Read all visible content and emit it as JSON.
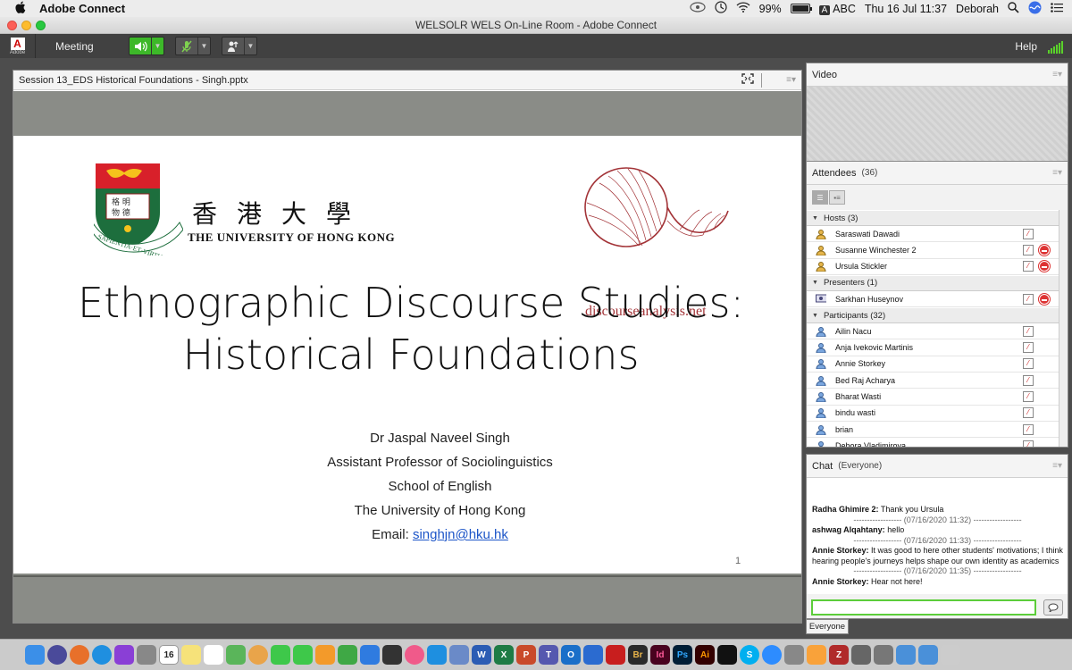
{
  "menubar": {
    "apple": "",
    "app_name": "Adobe Connect",
    "battery": "99%",
    "input_source": "ABC",
    "datetime": "Thu 16 Jul  11:37",
    "user": "Deborah"
  },
  "window": {
    "title": "WELSOLR WELS On-Line Room - Adobe Connect"
  },
  "toolbar": {
    "logo_sub": "Adobe",
    "meeting_label": "Meeting",
    "help_label": "Help"
  },
  "share_pod": {
    "title": "Session 13_EDS Historical Foundations - Singh.pptx",
    "slide": {
      "hku_chinese": "香港大學",
      "hku_name": "THE UNIVERSITY OF HONG KONG",
      "hku_motto": "SAPIENTIA·ET·VIRTUS",
      "da_name": "discourseanalysis.net",
      "title_line1": "Ethnographic Discourse Studies:",
      "title_line2": "Historical Foundations",
      "author": "Dr Jaspal Naveel Singh",
      "position": "Assistant Professor of Sociolinguistics",
      "school": "School of English",
      "university": "The University of Hong Kong",
      "email_label": "Email: ",
      "email": "singhjn@hku.hk",
      "page": "1"
    }
  },
  "video_pod": {
    "title": "Video"
  },
  "attendees_pod": {
    "title": "Attendees",
    "count": "(36)",
    "groups": {
      "hosts": "Hosts (3)",
      "presenters": "Presenters (1)",
      "participants": "Participants (32)"
    },
    "hosts": [
      "Saraswati Dawadi",
      "Susanne Winchester 2",
      "Ursula Stickler"
    ],
    "presenters": [
      "Sarkhan Huseynov"
    ],
    "participants": [
      "Ailin Nacu",
      "Anja Ivekovic Martinis",
      "Annie Storkey",
      "Bed Raj Acharya",
      "Bharat Wasti",
      "bindu wasti",
      "brian",
      "Debora Vladimirova"
    ]
  },
  "chat_pod": {
    "title": "Chat",
    "scope": "(Everyone)",
    "messages": [
      {
        "sender": "Radha Ghimire 2:",
        "text": " Thank you Ursula"
      },
      {
        "timestamp": "------------------ (07/16/2020 11:32) ------------------"
      },
      {
        "sender": "ashwag Alqahtany:",
        "text": " hello"
      },
      {
        "timestamp": "------------------ (07/16/2020 11:33) ------------------"
      },
      {
        "sender": "Annie Storkey:",
        "text": " It was good to here other students' motivations; I think hearing people's journeys helps shape our own identity as academics"
      },
      {
        "timestamp": "------------------ (07/16/2020 11:35) ------------------"
      },
      {
        "sender": "Annie Storkey:",
        "text": " Hear not here!"
      }
    ],
    "input_value": "",
    "send_to": "Everyone"
  },
  "dock": {
    "calendar_day": "16",
    "apps": [
      "finder",
      "siri",
      "firefox",
      "safari",
      "podcasts",
      "launchpad",
      "calendar",
      "notes",
      "reminders",
      "maps",
      "photos",
      "messages",
      "facetime",
      "pages",
      "numbers",
      "keynote",
      "quicktime",
      "itunes",
      "appstore",
      "preview",
      "word",
      "excel",
      "powerpoint",
      "teams",
      "outlook",
      "audio",
      "acrobat",
      "bridge",
      "indesign",
      "photoshop",
      "illustrator",
      "bbx",
      "skype",
      "zoom",
      "settings-gear",
      "sketch",
      "zotero",
      "screenshot",
      "system-prefs",
      "folder",
      "downloads",
      "trash"
    ]
  },
  "colors": {
    "toolbar_bg": "#414141",
    "accent_green": "#5ccd3a",
    "stop_red": "#d33333",
    "hku_title_text": "#111111",
    "da_brand": "#a33438",
    "email_link": "#1c55c8"
  }
}
